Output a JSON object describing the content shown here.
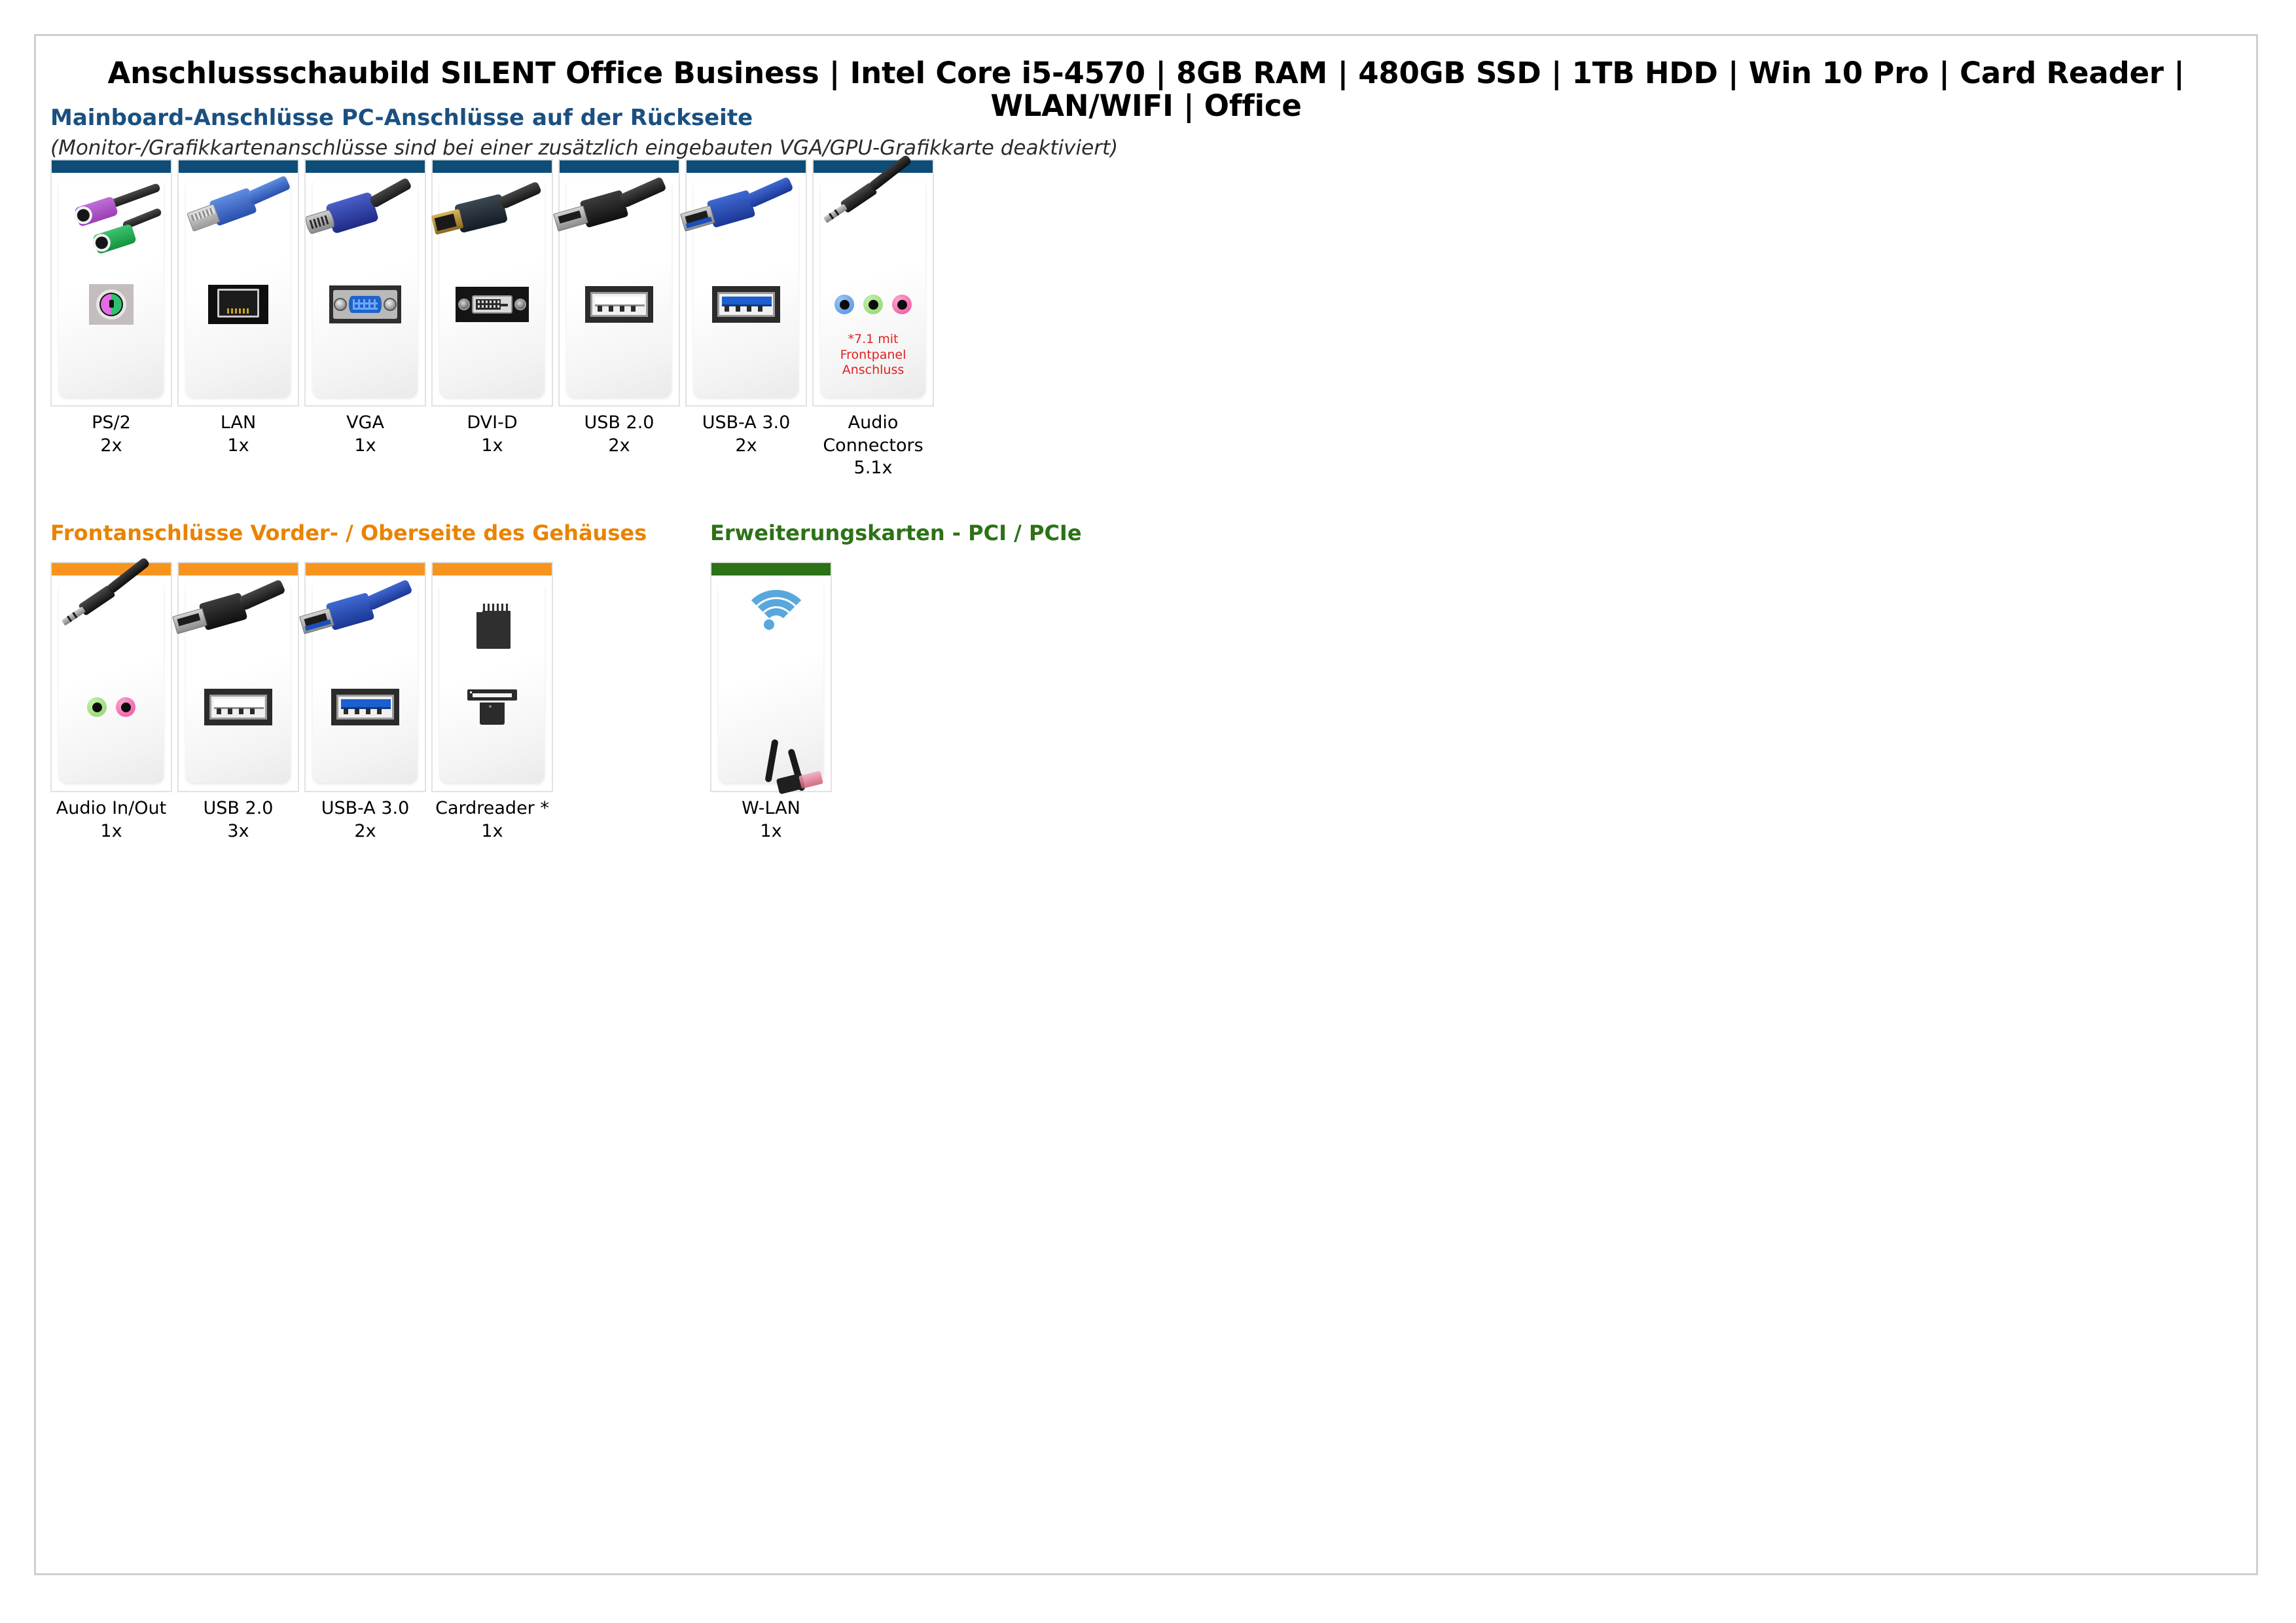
{
  "document": {
    "title": "Anschlussschaubild SILENT Office Business | Intel Core i5-4570 | 8GB RAM | 480GB SSD | 1TB HDD | Win 10 Pro | Card Reader | WLAN/WIFI | Office"
  },
  "sections": {
    "rear": {
      "heading": "Mainboard-Anschlüsse PC-Anschlüsse auf der Rückseite",
      "subheading": "(Monitor-/Grafikkartenanschlüsse sind bei einer zusätzlich eingebauten VGA/GPU-Grafikkarte deaktiviert)",
      "accent_color": "#0d4d77",
      "heading_color": "#1a5080",
      "cards": [
        {
          "label": "PS/2",
          "count": "2x",
          "icon": "ps2-connector-icon"
        },
        {
          "label": "LAN",
          "count": "1x",
          "icon": "rj45-lan-icon"
        },
        {
          "label": "VGA",
          "count": "1x",
          "icon": "vga-connector-icon"
        },
        {
          "label": "DVI-D",
          "count": "1x",
          "icon": "dvi-connector-icon"
        },
        {
          "label": "USB 2.0",
          "count": "2x",
          "icon": "usb-a-20-icon"
        },
        {
          "label": "USB-A 3.0",
          "count": "2x",
          "icon": "usb-a-30-icon"
        },
        {
          "label": "Audio Connectors",
          "count": "5.1x",
          "icon": "audio-jack-icon",
          "note": "*7.1 mit Frontpanel Anschluss",
          "note_color": "#e02020"
        }
      ]
    },
    "front": {
      "heading": "Frontanschlüsse Vorder- / Oberseite des Gehäuses",
      "accent_color": "#f7941d",
      "heading_color": "#e98300",
      "cards": [
        {
          "label": "Audio In/Out",
          "count": "1x",
          "icon": "audio-jack-icon"
        },
        {
          "label": "USB 2.0",
          "count": "3x",
          "icon": "usb-a-20-icon"
        },
        {
          "label": "USB-A 3.0",
          "count": "2x",
          "icon": "usb-a-30-icon"
        },
        {
          "label": "Cardreader *",
          "count": "1x",
          "icon": "sd-cardreader-icon"
        }
      ]
    },
    "expansion": {
      "heading": "Erweiterungskarten - PCI / PCIe",
      "accent_color": "#2c7216",
      "heading_color": "#2c7216",
      "cards": [
        {
          "label": "W-LAN",
          "count": "1x",
          "icon": "wifi-adapter-icon"
        }
      ]
    }
  }
}
